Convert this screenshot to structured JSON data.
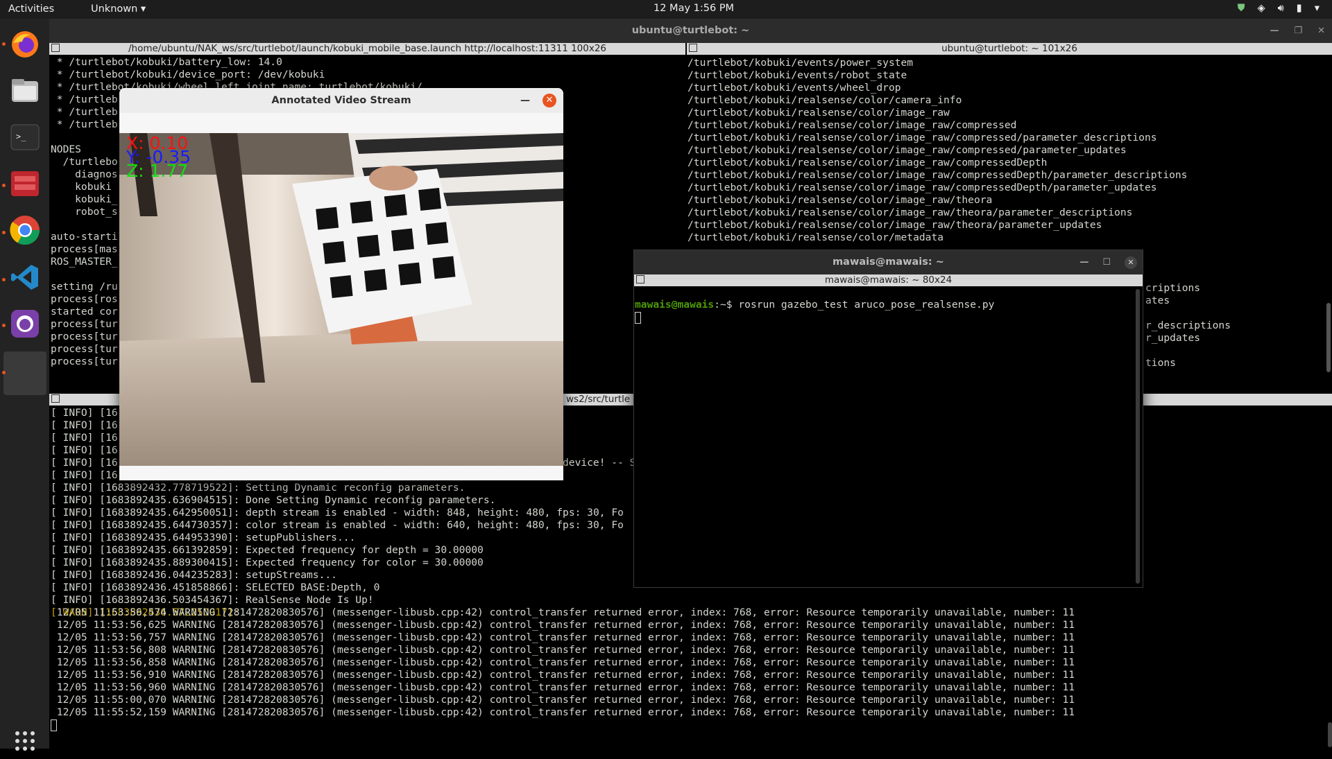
{
  "topbar": {
    "activities": "Activities",
    "app_menu": "Unknown",
    "clock": "12 May  1:56 PM",
    "tray_icons": [
      "shield-icon",
      "network-icon",
      "volume-icon",
      "battery-icon",
      "chevron-down-icon"
    ]
  },
  "dock": {
    "items": [
      "firefox-icon",
      "files-icon",
      "terminal-icon",
      "app-icon",
      "chrome-icon",
      "vscode-icon",
      "github-desktop-icon",
      "workspace-icon"
    ],
    "apps_grid": "apps-grid-icon"
  },
  "main_window": {
    "title": "ubuntu@turtlebot: ~",
    "top_left_pane": {
      "title": "/home/ubuntu/NAK_ws/src/turtlebot/launch/kobuki_mobile_base.launch http://localhost:11311 100x26",
      "lines": [
        " * /turtlebot/kobuki/battery_low: 14.0",
        " * /turtlebot/kobuki/device_port: /dev/kobuki",
        " * /turtlebot/kobuki/wheel_left_joint_name: turtlebot/kobuki/",
        " * /turtleb",
        " * /turtleb",
        " * /turtleb",
        "",
        "NODES",
        "  /turtlebo",
        "    diagnos",
        "    kobuki",
        "    kobuki_",
        "    robot_s",
        "",
        "auto-starti",
        "process[mas",
        "ROS_MASTER_",
        "",
        "setting /ru",
        "process[ros",
        "started cor",
        "process[tur",
        "process[tur",
        "process[tur",
        "process[tur"
      ]
    },
    "top_right_pane": {
      "title": "ubuntu@turtlebot: ~ 101x26",
      "lines": [
        "/turtlebot/kobuki/events/power_system",
        "/turtlebot/kobuki/events/robot_state",
        "/turtlebot/kobuki/events/wheel_drop",
        "/turtlebot/kobuki/realsense/color/camera_info",
        "/turtlebot/kobuki/realsense/color/image_raw",
        "/turtlebot/kobuki/realsense/color/image_raw/compressed",
        "/turtlebot/kobuki/realsense/color/image_raw/compressed/parameter_descriptions",
        "/turtlebot/kobuki/realsense/color/image_raw/compressed/parameter_updates",
        "/turtlebot/kobuki/realsense/color/image_raw/compressedDepth",
        "/turtlebot/kobuki/realsense/color/image_raw/compressedDepth/parameter_descriptions",
        "/turtlebot/kobuki/realsense/color/image_raw/compressedDepth/parameter_updates",
        "/turtlebot/kobuki/realsense/color/image_raw/theora",
        "/turtlebot/kobuki/realsense/color/image_raw/theora/parameter_descriptions",
        "/turtlebot/kobuki/realsense/color/image_raw/theora/parameter_updates",
        "/turtlebot/kobuki/realsense/color/metadata"
      ],
      "right_fragments": [
        "criptions",
        "ates",
        "",
        "r_descriptions",
        "r_updates",
        "",
        "tions"
      ]
    },
    "bottom_pane": {
      "title_fragment": "ws2/src/turtle",
      "short_lines": [
        "[ INFO] [16",
        "[ INFO] [16",
        "[ INFO] [16",
        "[ INFO] [16",
        "[ INFO] [16",
        "[ INFO] [16"
      ],
      "device_fragment": "device! -- S",
      "lines": [
        "[ INFO] [1683892432.778719522]: Setting Dynamic reconfig parameters.",
        "[ INFO] [1683892435.636904515]: Done Setting Dynamic reconfig parameters.",
        "[ INFO] [1683892435.642950051]: depth stream is enabled - width: 848, height: 480, fps: 30, Fo",
        "[ INFO] [1683892435.644730357]: color stream is enabled - width: 640, height: 480, fps: 30, Fo",
        "[ INFO] [1683892435.644953390]: setupPublishers...",
        "[ INFO] [1683892435.661392859]: Expected frequency for depth = 30.00000",
        "[ INFO] [1683892435.889300415]: Expected frequency for color = 30.00000",
        "[ INFO] [1683892436.044235283]: setupStreams...",
        "[ INFO] [1683892436.451858866]: SELECTED BASE:Depth, 0",
        "[ INFO] [1683892436.503454367]: RealSense Node Is Up!"
      ],
      "warn_line": "[ WARN] [1683892436.572250917]:",
      "warning_lines": [
        " 12/05 11:53:56,574 WARNING [281472820830576] (messenger-libusb.cpp:42) control_transfer returned error, index: 768, error: Resource temporarily unavailable, number: 11",
        " 12/05 11:53:56,625 WARNING [281472820830576] (messenger-libusb.cpp:42) control_transfer returned error, index: 768, error: Resource temporarily unavailable, number: 11",
        " 12/05 11:53:56,757 WARNING [281472820830576] (messenger-libusb.cpp:42) control_transfer returned error, index: 768, error: Resource temporarily unavailable, number: 11",
        " 12/05 11:53:56,808 WARNING [281472820830576] (messenger-libusb.cpp:42) control_transfer returned error, index: 768, error: Resource temporarily unavailable, number: 11",
        " 12/05 11:53:56,858 WARNING [281472820830576] (messenger-libusb.cpp:42) control_transfer returned error, index: 768, error: Resource temporarily unavailable, number: 11",
        " 12/05 11:53:56,910 WARNING [281472820830576] (messenger-libusb.cpp:42) control_transfer returned error, index: 768, error: Resource temporarily unavailable, number: 11",
        " 12/05 11:53:56,960 WARNING [281472820830576] (messenger-libusb.cpp:42) control_transfer returned error, index: 768, error: Resource temporarily unavailable, number: 11",
        " 12/05 11:55:00,070 WARNING [281472820830576] (messenger-libusb.cpp:42) control_transfer returned error, index: 768, error: Resource temporarily unavailable, number: 11",
        " 12/05 11:55:52,159 WARNING [281472820830576] (messenger-libusb.cpp:42) control_transfer returned error, index: 768, error: Resource temporarily unavailable, number: 11"
      ]
    }
  },
  "video_window": {
    "title": "Annotated Video Stream",
    "readout": {
      "x": "X: 0.10",
      "y": "Y: -0.35",
      "z": "Z: 1.77"
    },
    "colors": {
      "x": "#ff1010",
      "y": "#1a1aff",
      "z": "#10e010"
    }
  },
  "mawais_window": {
    "title": "mawais@mawais: ~",
    "tab_title": "mawais@mawais: ~ 80x24",
    "prompt": "mawais@mawais",
    "prompt_suffix": ":~$ ",
    "command": "rosrun gazebo_test aruco_pose_realsense.py"
  }
}
